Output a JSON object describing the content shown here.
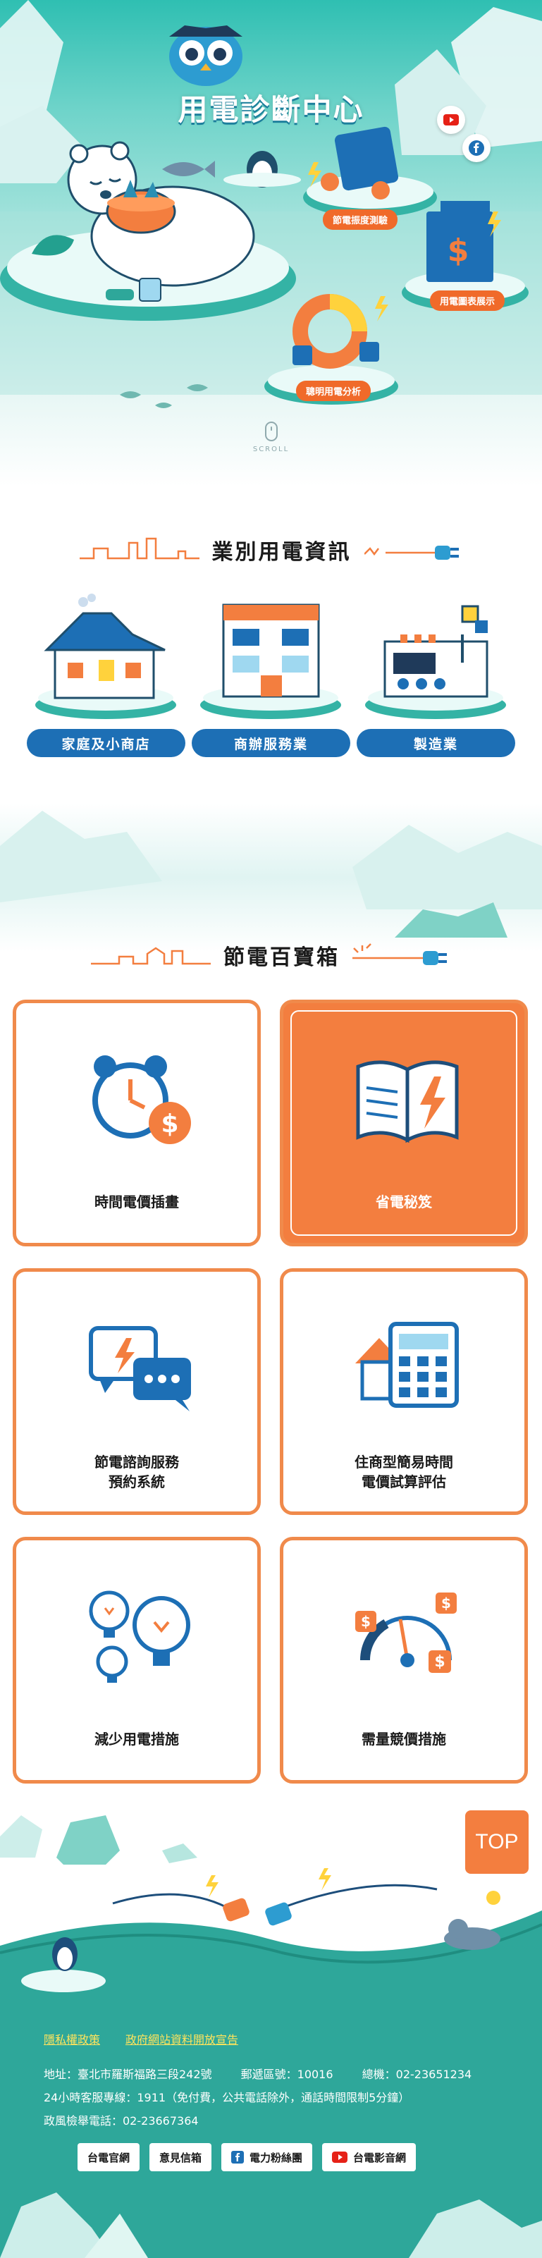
{
  "hero": {
    "title": "用電診斷中心",
    "pill_bill_check": "節電振度測驗",
    "pill_chart": "用電圖表展示",
    "pill_analysis": "聰明用電分析",
    "scroll_label": "SCROLL",
    "social": [
      "youtube-icon",
      "facebook-icon"
    ]
  },
  "industry": {
    "heading": "業別用電資訊",
    "items": [
      {
        "label": "家庭及小商店",
        "icon": "house-icon"
      },
      {
        "label": "商辦服務業",
        "icon": "office-building-icon"
      },
      {
        "label": "製造業",
        "icon": "factory-icon"
      }
    ]
  },
  "tips": {
    "heading": "節電百寶箱",
    "items": [
      {
        "label": [
          "時間電價插畫"
        ],
        "icon": "alarm-clock-money-icon",
        "active": false
      },
      {
        "label": [
          "省電秘笈"
        ],
        "icon": "open-book-bolt-icon",
        "active": true
      },
      {
        "label": [
          "節電諮詢服務",
          "預約系統"
        ],
        "icon": "chat-bubbles-icon",
        "active": false
      },
      {
        "label": [
          "住商型簡易時間",
          "電價試算評估"
        ],
        "icon": "house-calculator-icon",
        "active": false
      },
      {
        "label": [
          "減少用電措施"
        ],
        "icon": "light-bulbs-icon",
        "active": false
      },
      {
        "label": [
          "需量競價措施"
        ],
        "icon": "gauge-dollar-icon",
        "active": false
      }
    ]
  },
  "top_label": "TOP",
  "footer": {
    "links": [
      "隱私權政策",
      "政府網站資料開放宣告"
    ],
    "address": "地址：臺北市羅斯福路三段242號",
    "postal": "郵遞區號：10016",
    "phone": "總機：02-23651234",
    "service": "24小時客服專線：1911（免付費，公共電話除外，通話時間限制5分鐘）",
    "ethics": "政風檢舉電話：02-23667364",
    "buttons": [
      {
        "label": "台電官網",
        "icon": ""
      },
      {
        "label": "意見信箱",
        "icon": ""
      },
      {
        "label": "電力粉絲團",
        "icon": "facebook-icon"
      },
      {
        "label": "台電影音網",
        "icon": "youtube-icon"
      }
    ]
  },
  "colors": {
    "orange": "#f37e3f",
    "blue": "#1d6fb5",
    "teal": "#2ea79a",
    "yellow": "#ffe45c"
  }
}
